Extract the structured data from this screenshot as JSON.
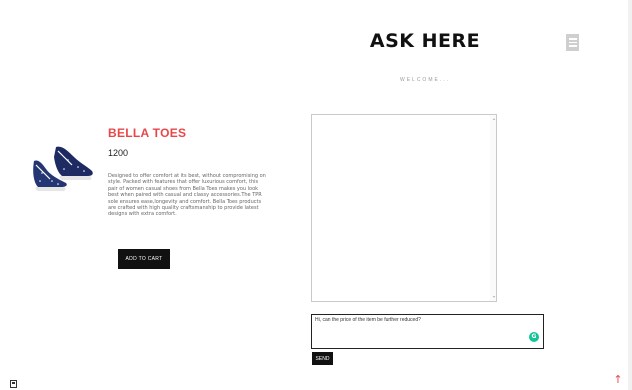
{
  "header": {
    "title": "ASK HERE",
    "menu_icon": "hamburger-menu-icon",
    "welcome_text": "WELCOME..."
  },
  "product": {
    "image_icon": "sneaker-image",
    "name": "BELLA TOES",
    "price": "1200",
    "description": "Designed to offer comfort at its best, without compromising on style. Packed with features that offer luxurious comfort, this pair of women casual shoes from Bella Toes makes you look best when paired with casual and classy accessories.The TPR sole ensures ease,longevity and comfort. Bella Toes products are crafted with high quality craftsmanship to provide latest designs with extra comfort.",
    "add_to_cart_label": "ADD TO CART"
  },
  "chat": {
    "messages_value": "",
    "input_value": "Hi, can the price of the item be further reduced?",
    "grammarly_icon": "G",
    "send_label": "SEND"
  },
  "footer": {
    "back_to_top_icon": "↑"
  },
  "colors": {
    "accent": "#e8474a",
    "button_bg": "#111111",
    "grammarly": "#15c39a"
  }
}
